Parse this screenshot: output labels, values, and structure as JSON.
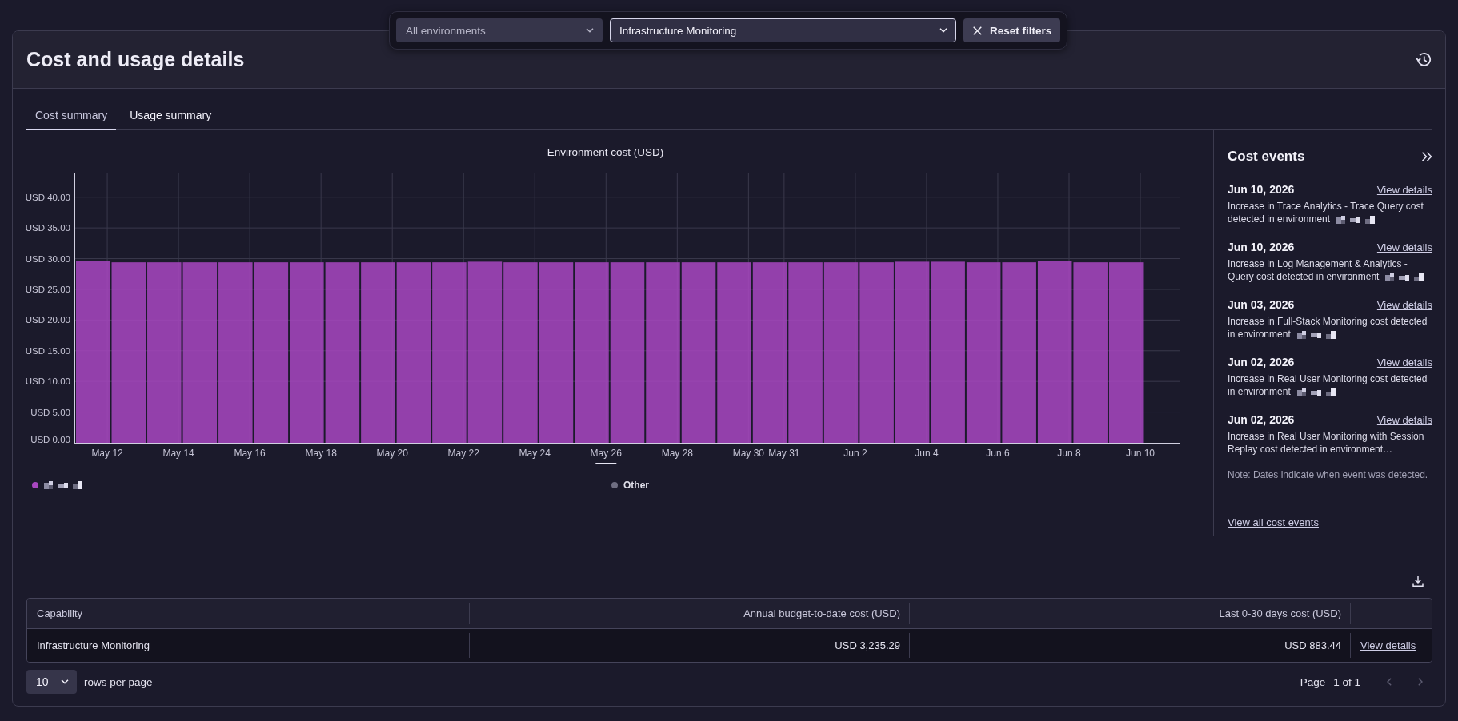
{
  "filter_bar": {
    "dropdowns": [
      {
        "value": "All environments",
        "active": false
      },
      {
        "value": "Infrastructure Monitoring",
        "active": true
      }
    ],
    "reset_button": "Reset filters"
  },
  "header": {
    "title": "Cost and usage details"
  },
  "tabs": [
    {
      "label": "Cost summary",
      "selected": true
    },
    {
      "label": "Usage summary",
      "selected": false
    }
  ],
  "chart": {
    "legend": [
      {
        "label_redacted": true
      },
      {
        "label_redacted": false
      }
    ],
    "x_label_underlined": [
      false,
      false,
      false,
      false,
      false,
      false,
      false,
      true,
      false,
      false,
      false,
      false,
      false,
      false,
      false,
      false
    ],
    "y_tick_units": [
      "USD",
      "USD",
      "USD",
      "USD",
      "USD",
      "USD",
      "USD",
      "USD",
      "USD"
    ],
    "chart_data": {
      "type": "bar",
      "title": "Environment cost (USD)",
      "grid": true,
      "categories": [
        "May 12",
        null,
        "May 14",
        null,
        "May 16",
        null,
        "May 18",
        null,
        "May 20",
        null,
        "May 22",
        null,
        "May 24",
        null,
        "May 26",
        null,
        "May 28",
        null,
        "May 30",
        "May 31",
        null,
        "Jun 2",
        null,
        "Jun 4",
        null,
        "Jun 6",
        null,
        "Jun 8",
        null,
        "Jun 10",
        null
      ],
      "ylim": [
        0,
        44
      ],
      "yticks": [
        {
          "value": 0,
          "label": "0.00"
        },
        {
          "value": 5,
          "label": "5.00"
        },
        {
          "value": 10,
          "label": "10.00"
        },
        {
          "value": 15,
          "label": "15.00"
        },
        {
          "value": 20,
          "label": "20.00"
        },
        {
          "value": 25,
          "label": "25.00"
        },
        {
          "value": 30,
          "label": "30.00"
        },
        {
          "value": 35,
          "label": "35.00"
        },
        {
          "value": 40,
          "label": "40.00"
        }
      ],
      "series": [
        {
          "color": "#a847c0",
          "values": [
            29.6,
            29.4,
            29.4,
            29.4,
            29.4,
            29.4,
            29.4,
            29.4,
            29.4,
            29.4,
            29.4,
            29.5,
            29.4,
            29.4,
            29.4,
            29.4,
            29.4,
            29.4,
            29.4,
            29.4,
            29.4,
            29.4,
            29.4,
            29.5,
            29.5,
            29.4,
            29.4,
            29.6,
            29.4,
            29.4,
            null
          ]
        },
        {
          "name": "Other",
          "color": "#6f6e82",
          "values": [
            0,
            0,
            0,
            0,
            0,
            0,
            0,
            0,
            0,
            0,
            0,
            0,
            0,
            0,
            0,
            0,
            0,
            0,
            0,
            0,
            0,
            0,
            0,
            0,
            0,
            0,
            0,
            0,
            0,
            0,
            null
          ]
        }
      ]
    }
  },
  "cost_events": {
    "title": "Cost events",
    "events": [
      {
        "date": "Jun 10, 2026",
        "link": "View details",
        "description": "Increase in Trace Analytics - Trace Query cost detected in environment",
        "environment_redacted": true
      },
      {
        "date": "Jun 10, 2026",
        "link": "View details",
        "description": "Increase in Log Management & Analytics - Query cost detected in environment",
        "environment_redacted": true
      },
      {
        "date": "Jun 03, 2026",
        "link": "View details",
        "description": "Increase in Full-Stack Monitoring cost detected in environment",
        "environment_redacted": true
      },
      {
        "date": "Jun 02, 2026",
        "link": "View details",
        "description": "Increase in Real User Monitoring cost detected in environment",
        "environment_redacted": true
      },
      {
        "date": "Jun 02, 2026",
        "link": "View details",
        "description": "Increase in Real User Monitoring with Session Replay cost detected in environment…",
        "environment_redacted": false
      }
    ],
    "note": "Note: Dates indicate when event was detected.",
    "view_all_link": "View all cost events"
  },
  "table": {
    "columns": [
      "Capability",
      "Annual budget-to-date cost (USD)",
      "Last 0-30 days cost (USD)"
    ],
    "rows": [
      {
        "cells": [
          "Infrastructure Monitoring",
          "USD 3,235.29",
          "USD 883.44"
        ],
        "link": "View details"
      }
    ]
  },
  "pagination": {
    "page_size": "10",
    "rows_per_page_label": "rows per page",
    "page_label": "Page",
    "page_status": "1 of 1",
    "previous_disabled": true,
    "next_disabled": true
  }
}
